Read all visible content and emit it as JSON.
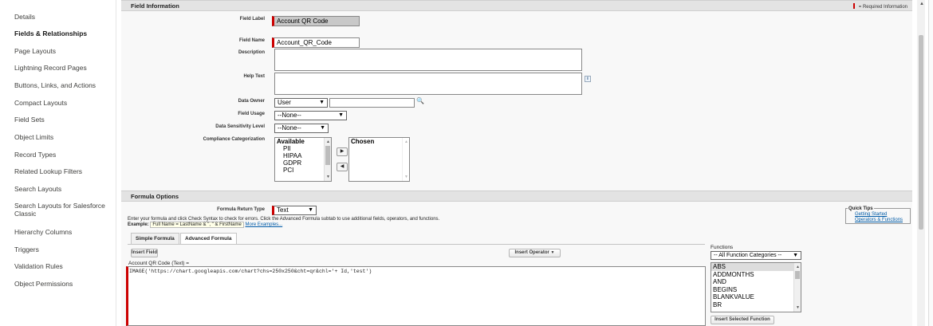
{
  "sidebar": {
    "items": [
      {
        "label": "Details"
      },
      {
        "label": "Fields & Relationships"
      },
      {
        "label": "Page Layouts"
      },
      {
        "label": "Lightning Record Pages"
      },
      {
        "label": "Buttons, Links, and Actions"
      },
      {
        "label": "Compact Layouts"
      },
      {
        "label": "Field Sets"
      },
      {
        "label": "Object Limits"
      },
      {
        "label": "Record Types"
      },
      {
        "label": "Related Lookup Filters"
      },
      {
        "label": "Search Layouts"
      },
      {
        "label": "Search Layouts for Salesforce Classic"
      },
      {
        "label": "Hierarchy Columns"
      },
      {
        "label": "Triggers"
      },
      {
        "label": "Validation Rules"
      },
      {
        "label": "Object Permissions"
      }
    ],
    "active": "Fields & Relationships"
  },
  "field_info": {
    "title": "Field Information",
    "required_note": "= Required Information",
    "field_label_label": "Field Label",
    "field_label_value": "Account QR Code",
    "field_name_label": "Field Name",
    "field_name_value": "Account_QR_Code",
    "description_label": "Description",
    "help_text_label": "Help Text",
    "data_owner_label": "Data Owner",
    "data_owner_value": "User",
    "field_usage_label": "Field Usage",
    "field_usage_value": "--None--",
    "sensitivity_label": "Data Sensitivity Level",
    "sensitivity_value": "--None--",
    "compliance_label": "Compliance Categorization",
    "available_header": "Available",
    "available_options": [
      "PII",
      "HIPAA",
      "GDPR",
      "PCI"
    ],
    "chosen_header": "Chosen",
    "add_arrow": "▶",
    "remove_arrow": "◀",
    "info_glyph": "i",
    "lookup_glyph": "🔍"
  },
  "formula": {
    "title": "Formula Options",
    "return_type_label": "Formula Return Type",
    "return_type_value": "Text",
    "instructions": "Enter your formula and click Check Syntax to check for errors. Click the Advanced Formula subtab to use additional fields, operators, and functions.",
    "example_label": "Example:",
    "example_code": "Full Name = LastName & \", \" & FirstName",
    "more_examples": "More Examples...",
    "tabs": [
      "Simple Formula",
      "Advanced Formula"
    ],
    "insert_field": "Insert Field",
    "insert_operator": "Insert Operator",
    "insert_operator_chev": "▼",
    "editor_label": "Account QR Code (Text) =",
    "editor_value": "IMAGE('https://chart.googleapis.com/chart?chs=250x250&cht=qr&chl='+ Id,'test')",
    "functions_label": "Functions",
    "function_category": "-- All Function Categories --",
    "function_list": [
      "ABS",
      "ADDMONTHS",
      "AND",
      "BEGINS",
      "BLANKVALUE",
      "BR"
    ],
    "selected_function": "ABS",
    "insert_selected_function": "Insert Selected Function",
    "quick_tips_title": "Quick Tips",
    "quick_tips_links": [
      "Getting Started",
      "Operators & Functions"
    ]
  },
  "colors": {
    "required": "#cc0000",
    "link": "#015ba7",
    "section_header": "#e3e3e3"
  }
}
